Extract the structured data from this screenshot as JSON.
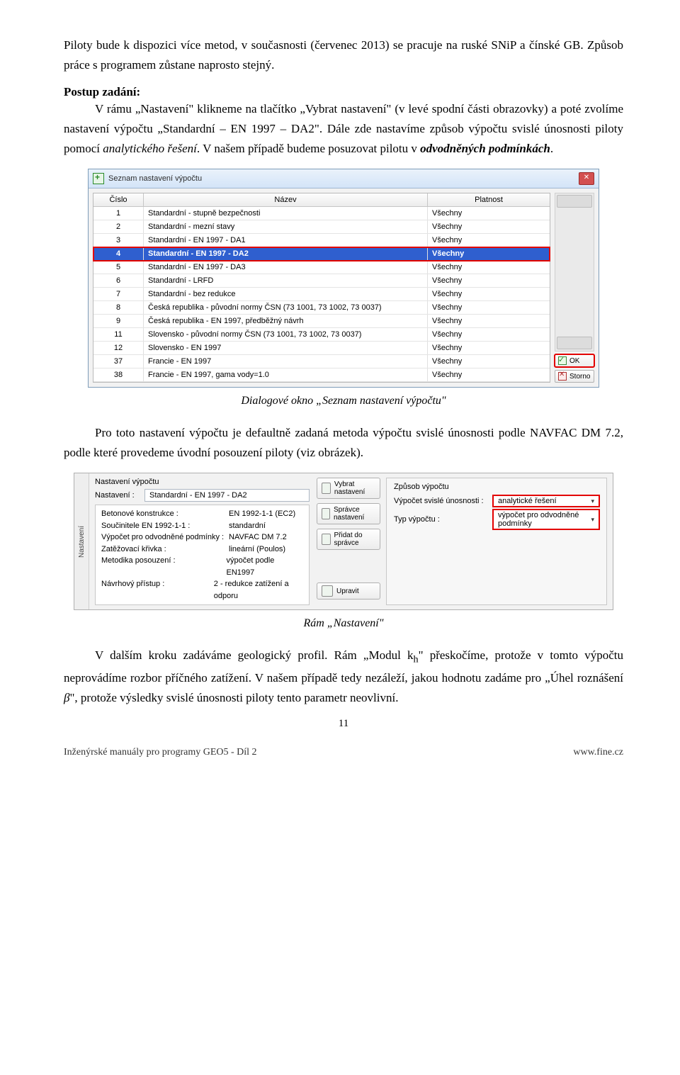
{
  "paragraphs": {
    "p1": "Piloty bude k dispozici více metod, v současnosti (červenec 2013) se pracuje na ruské SNiP a čínské GB. Způsob práce s programem zůstane naprosto stejný.",
    "heading1": "Postup zadání:",
    "p2_a": "V rámu „Nastavení\" klikneme na tlačítko „Vybrat nastavení\" (v levé spodní části obrazovky) a poté zvolíme nastavení výpočtu „Standardní – EN 1997 – DA2\". Dále zde nastavíme způsob výpočtu svislé únosnosti piloty pomocí ",
    "p2_italic1": "analytického řešení",
    "p2_b": ". V našem případě budeme posuzovat pilotu v ",
    "p2_bolditalic": "odvodněných podmínkách",
    "p2_c": ".",
    "caption1": "Dialogové okno „Seznam nastavení výpočtu\"",
    "p3_a": "Pro toto nastavení výpočtu je defaultně zadaná metoda výpočtu svislé únosnosti podle NAVFAC DM 7.2, podle které provedeme úvodní posouzení piloty (viz obrázek).",
    "caption2": "Rám „Nastavení\"",
    "p4_a": "V dalším kroku zadáváme geologický profil. Rám „Modul ",
    "p4_sym": "k",
    "p4_sub": "h",
    "p4_b": "\" přeskočíme, protože v tomto výpočtu neprovádíme rozbor příčného zatížení. V našem případě tedy nezáleží, jakou hodnotu zadáme pro „Úhel roznášení ",
    "p4_beta": "β",
    "p4_c": "\", protože výsledky svislé únosnosti piloty tento parametr neovlivní."
  },
  "dialog": {
    "title": "Seznam nastavení výpočtu",
    "headers": {
      "num": "Číslo",
      "name": "Název",
      "valid": "Platnost"
    },
    "rows": [
      {
        "num": "1",
        "name": "Standardní - stupně bezpečnosti",
        "valid": "Všechny"
      },
      {
        "num": "2",
        "name": "Standardní - mezní stavy",
        "valid": "Všechny"
      },
      {
        "num": "3",
        "name": "Standardní - EN 1997 - DA1",
        "valid": "Všechny"
      },
      {
        "num": "4",
        "name": "Standardní - EN 1997 - DA2",
        "valid": "Všechny",
        "highlight": true
      },
      {
        "num": "5",
        "name": "Standardní - EN 1997 - DA3",
        "valid": "Všechny"
      },
      {
        "num": "6",
        "name": "Standardní - LRFD",
        "valid": "Všechny"
      },
      {
        "num": "7",
        "name": "Standardní - bez redukce",
        "valid": "Všechny"
      },
      {
        "num": "8",
        "name": "Česká republika - původní normy ČSN (73 1001, 73 1002, 73 0037)",
        "valid": "Všechny"
      },
      {
        "num": "9",
        "name": "Česká republika - EN 1997, předběžný návrh",
        "valid": "Všechny"
      },
      {
        "num": "11",
        "name": "Slovensko - původní normy ČSN (73 1001, 73 1002, 73 0037)",
        "valid": "Všechny"
      },
      {
        "num": "12",
        "name": "Slovensko - EN 1997",
        "valid": "Všechny"
      },
      {
        "num": "37",
        "name": "Francie - EN 1997",
        "valid": "Všechny"
      },
      {
        "num": "38",
        "name": "Francie - EN 1997, gama vody=1.0",
        "valid": "Všechny"
      }
    ],
    "ok": "OK",
    "cancel": "Storno"
  },
  "panel": {
    "tab": "Nastavení",
    "group": "Nastavení výpočtu",
    "label": "Nastavení :",
    "setting_value": "Standardní - EN 1997 - DA2",
    "box": [
      {
        "k": "Betonové konstrukce :",
        "v": "EN 1992-1-1 (EC2)"
      },
      {
        "k": "Součinitele EN 1992-1-1 :",
        "v": "standardní"
      },
      {
        "k": "Výpočet pro odvodněné podmínky :",
        "v": "NAVFAC DM 7.2"
      },
      {
        "k": "Zatěžovací křivka :",
        "v": "lineární (Poulos)"
      },
      {
        "k": "Metodika posouzení :",
        "v": "výpočet podle EN1997"
      },
      {
        "k": "Návrhový přístup :",
        "v": "2 - redukce zatížení a odporu"
      }
    ],
    "buttons": {
      "vybrat": "Vybrat nastavení",
      "spravce": "Správce nastavení",
      "pridat": "Přidat do správce",
      "upravit": "Upravit"
    },
    "right": {
      "title": "Způsob výpočtu",
      "r1_label": "Výpočet svislé únosnosti :",
      "r1_value": "analytické řešení",
      "r2_label": "Typ výpočtu :",
      "r2_value": "výpočet pro odvodněné podmínky"
    }
  },
  "page_number": "11",
  "footer_left": "Inženýrské manuály pro programy GEO5 - Díl 2",
  "footer_right": "www.fine.cz"
}
